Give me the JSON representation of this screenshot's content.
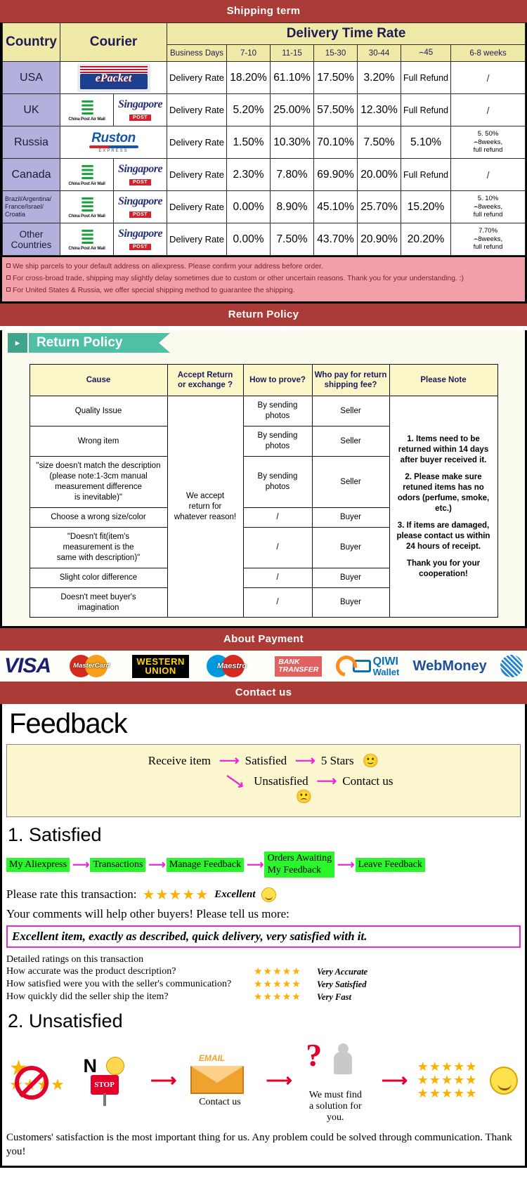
{
  "banners": {
    "shipping": "Shipping term",
    "return": "Return Policy",
    "payment": "About Payment",
    "contact": "Contact us"
  },
  "shipping": {
    "headers": {
      "country": "Country",
      "courier": "Courier",
      "delivery_time_rate": "Delivery Time Rate",
      "business_days": "Business Days",
      "ranges": [
        "7-10",
        "11-15",
        "15-30",
        "30-44",
        "⌢45",
        "6-8 weeks"
      ]
    },
    "row_label": "Delivery Rate",
    "rows": [
      {
        "country": "USA",
        "couriers": [
          "epacket"
        ],
        "d7_10": "18.20%",
        "d11_15": "61.10%",
        "d15_30": "17.50%",
        "d30_44": "3.20%",
        "over45": "Full Refund",
        "weeks68": "/"
      },
      {
        "country": "UK",
        "couriers": [
          "china-post-air-mail",
          "singapore-post"
        ],
        "d7_10": "5.20%",
        "d11_15": "25.00%",
        "d15_30": "57.50%",
        "d30_44": "12.30%",
        "over45": "Full Refund",
        "weeks68": "/"
      },
      {
        "country": "Russia",
        "couriers": [
          "ruston-express"
        ],
        "d7_10": "1.50%",
        "d11_15": "10.30%",
        "d15_30": "70.10%",
        "d30_44": "7.50%",
        "over45": "5.10%",
        "weeks68": "5. 50%\n⌢8weeks,\nfull refund"
      },
      {
        "country": "Canada",
        "couriers": [
          "china-post-air-mail",
          "singapore-post"
        ],
        "d7_10": "2.30%",
        "d11_15": "7.80%",
        "d15_30": "69.90%",
        "d30_44": "20.00%",
        "over45": "Full Refund",
        "weeks68": "/"
      },
      {
        "country": "Brazil/Argentina/\nFrance/Israel/\nCroatia",
        "couriers": [
          "china-post-air-mail",
          "singapore-post"
        ],
        "d7_10": "0.00%",
        "d11_15": "8.90%",
        "d15_30": "45.10%",
        "d30_44": "25.70%",
        "over45": "15.20%",
        "weeks68": "5. 10%\n⌢8weeks,\nfull refund"
      },
      {
        "country": "Other Countries",
        "couriers": [
          "china-post-air-mail",
          "singapore-post"
        ],
        "d7_10": "0.00%",
        "d11_15": "7.50%",
        "d15_30": "43.70%",
        "d30_44": "20.90%",
        "over45": "20.20%",
        "weeks68": "7.70%\n⌢8weeks,\nfull refund"
      }
    ],
    "notes": [
      "We ship parcels to your default address on aliexpress. Please confirm your address before order.",
      "For cross-broad trade, shipping may slightly delay sometimes due to custom or other uncertain reasons. Thank you for your understanding. :)",
      "For United States & Russia, we offer special shipping method to guarantee the shipping."
    ],
    "logo_labels": {
      "epacket": "ePacket",
      "china_post": "China Post Air Mail",
      "china_post_mark": "≣",
      "singapore_post_word": "Singapore",
      "singapore_post_tag": "POST",
      "ruston_word": "Ruston",
      "ruston_sub": "EXPRESS"
    }
  },
  "return_policy": {
    "ribbon_title": "Return Policy",
    "ribbon_icon": "▸",
    "headers": [
      "Cause",
      "Accept Return\nor exchange ?",
      "How to prove?",
      "Who pay for return\nshipping fee?",
      "Please Note"
    ],
    "accept_text": "We accept\nreturn for\nwhatever reason!",
    "rows": [
      {
        "cause": "Quality Issue",
        "prove": "By sending\nphotos",
        "payer": "Seller"
      },
      {
        "cause": "Wrong item",
        "prove": "By sending\nphotos",
        "payer": "Seller"
      },
      {
        "cause": "\"size doesn't match the description\n(please note:1-3cm manual\nmeasurement difference\nis inevitable)\"",
        "prove": "By sending\nphotos",
        "payer": "Seller"
      },
      {
        "cause": "Choose a wrong size/color",
        "prove": "/",
        "payer": "Buyer"
      },
      {
        "cause": "\"Doesn't fit(item's\nmeasurement is the\nsame with description)\"",
        "prove": "/",
        "payer": "Buyer"
      },
      {
        "cause": "Slight color difference",
        "prove": "/",
        "payer": "Buyer"
      },
      {
        "cause": "Doesn't meet buyer's\nimagination",
        "prove": "/",
        "payer": "Buyer"
      }
    ],
    "notes": [
      "1. Items need to be returned within 14 days after buyer received it.",
      "2. Please make sure retuned items has no odors (perfume, smoke, etc.)",
      "3. If items are damaged, please contact us within 24 hours of receipt.",
      "Thank you for your cooperation!"
    ]
  },
  "payment": {
    "methods": [
      {
        "name": "visa",
        "label": "VISA"
      },
      {
        "name": "mastercard",
        "label": "MasterCard"
      },
      {
        "name": "western-union",
        "label_1": "WESTERN",
        "label_2": "UNION"
      },
      {
        "name": "maestro",
        "label": "Maestro"
      },
      {
        "name": "bank-transfer",
        "label_1": "BANK",
        "label_2": "TRANSFER"
      },
      {
        "name": "qiwi-wallet",
        "label_1": "QIWI",
        "label_2": "Wallet"
      },
      {
        "name": "webmoney",
        "label": "WebMoney"
      },
      {
        "name": "webmoney-globe",
        "label": ""
      }
    ]
  },
  "feedback": {
    "title": "Feedback",
    "flow": {
      "receive": "Receive item",
      "satisfied": "Satisfied",
      "five_stars": "5 Stars",
      "unsatisfied": "Unsatisfied",
      "contact_us": "Contact us",
      "happy_emoji": "🙂",
      "sad_emoji": "🙁"
    },
    "satisfied": {
      "heading": "1. Satisfied",
      "chain": [
        "My Aliexpress",
        "Transactions",
        "Manage Feedback",
        "Orders Awaiting\nMy Feedback",
        "Leave Feedback"
      ],
      "rate_label": "Please rate this transaction:",
      "stars": "★★★★★",
      "rate_word": "Excellent",
      "comments_label": "Your comments will help other buyers! Please tell us more:",
      "quote": "Excellent item, exactly as described, quick delivery, very satisfied with it.",
      "detailed_title": "Detailed ratings on this transaction",
      "details": [
        {
          "question": "How accurate was the product description?",
          "stars": "★★★★★",
          "value": "Very Accurate"
        },
        {
          "question": "How satisfied were you with the seller's communication?",
          "stars": "★★★★★",
          "value": "Very Satisfied"
        },
        {
          "question": "How quickly did the seller ship the item?",
          "stars": "★★★★★",
          "value": "Very Fast"
        }
      ]
    },
    "unsatisfied": {
      "heading": "2. Unsatisfied",
      "no_label": "N",
      "stop_label": "STOP",
      "email_label": "EMAIL",
      "contact_caption": "Contact us",
      "solution_caption": "We must find\na solution for\nyou.",
      "stars_block": "★★★★★\n★★★★★\n★★★★★",
      "closing": "Customers' satisfaction is the most important thing for us. Any problem could be solved through communication. Thank you!"
    }
  },
  "colors": {
    "banner_red": "#ab3b36",
    "header_yellow": "#efeaa8",
    "country_purple": "#b4b0dd",
    "note_pink": "#f2a0a7",
    "ribbon_green": "#4fc0a3",
    "chain_green": "#2bf52b",
    "magenta": "#ee27d6",
    "star_gold": "#fcb000"
  }
}
